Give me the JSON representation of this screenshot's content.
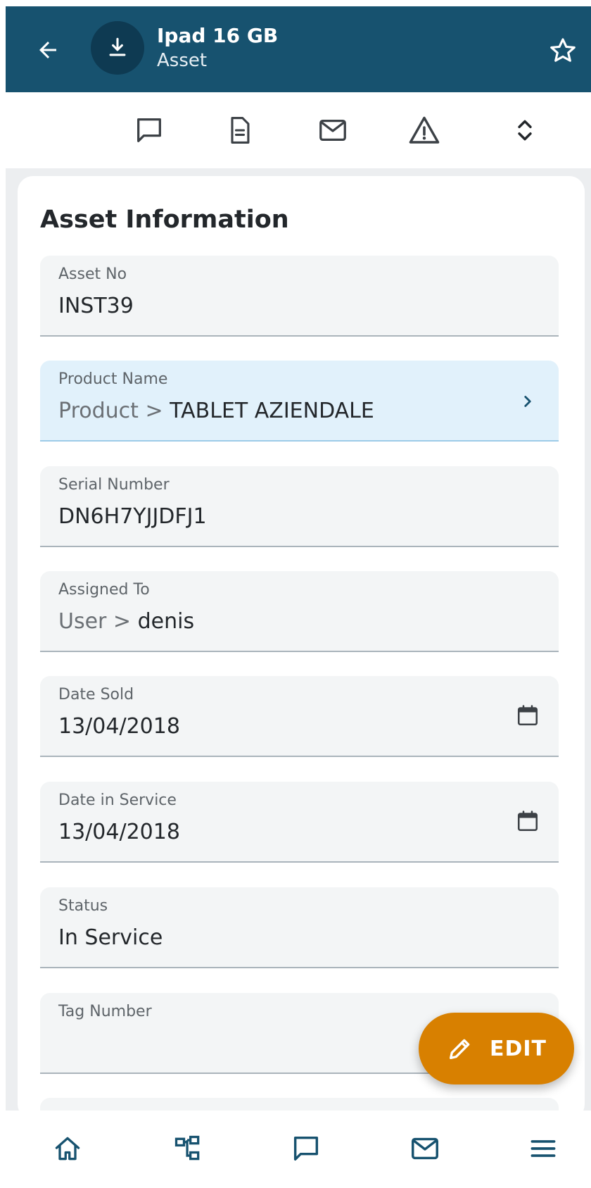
{
  "header": {
    "title": "Ipad 16 GB",
    "subtitle": "Asset"
  },
  "icons": {
    "back": "arrow-left-icon",
    "avatar": "download-icon",
    "favorite": "star-outline-icon",
    "comment": "comment-icon",
    "document": "document-icon",
    "mail": "mail-icon",
    "alert": "warning-icon",
    "expand": "unfold-icon",
    "calendar": "calendar-icon",
    "chevron": "chevron-right-icon",
    "edit": "pencil-icon"
  },
  "card": {
    "title": "Asset Information",
    "fields": [
      {
        "label": "Asset No",
        "value": "INST39"
      },
      {
        "label": "Product Name",
        "prefix": "Product > ",
        "value": "TABLET AZIENDALE"
      },
      {
        "label": "Serial Number",
        "value": "DN6H7YJJDFJ1"
      },
      {
        "label": "Assigned To",
        "prefix": "User > ",
        "value": "denis"
      },
      {
        "label": "Date Sold",
        "value": "13/04/2018"
      },
      {
        "label": "Date in Service",
        "value": "13/04/2018"
      },
      {
        "label": "Status",
        "value": "In Service"
      },
      {
        "label": "Tag Number",
        "value": ""
      }
    ]
  },
  "fab": {
    "label": "EDIT"
  },
  "nav": [
    "home-icon",
    "hierarchy-icon",
    "comment-icon",
    "mail-icon",
    "menu-icon"
  ],
  "colors": {
    "header": "#17526f",
    "accent": "#d88000",
    "highlight": "#e1f1fb"
  }
}
